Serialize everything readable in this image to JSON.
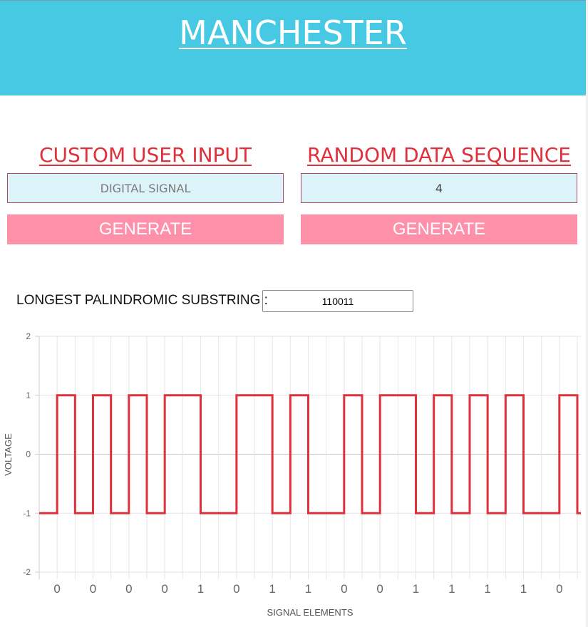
{
  "header": {
    "title": "MANCHESTER",
    "bg_color": "#48c9e3"
  },
  "custom_input": {
    "heading": "CUSTOM USER INPUT",
    "placeholder": "DIGITAL SIGNAL",
    "button_label": "GENERATE"
  },
  "random_sequence": {
    "heading": "RANDOM DATA SEQUENCE",
    "value": "4",
    "button_label": "GENERATE"
  },
  "palindrome": {
    "label": "LONGEST PALINDROMIC SUBSTRING :",
    "value": "110011"
  },
  "colors": {
    "accent": "#e0303c",
    "button": "#ff90aa",
    "input_bg": "#dbf3f9",
    "line": "#e0303c"
  },
  "chart_data": {
    "type": "line",
    "step": true,
    "bits": [
      "0",
      "0",
      "0",
      "0",
      "1",
      "0",
      "1",
      "1",
      "0",
      "0",
      "1",
      "1",
      "1",
      "1",
      "0"
    ],
    "encoding": "Manchester",
    "xlabel": "SIGNAL ELEMENTS",
    "ylabel": "VOLTAGE",
    "ylim": [
      -2,
      2
    ],
    "yticks": [
      2,
      1,
      0,
      -1,
      -2
    ],
    "grid": true
  }
}
